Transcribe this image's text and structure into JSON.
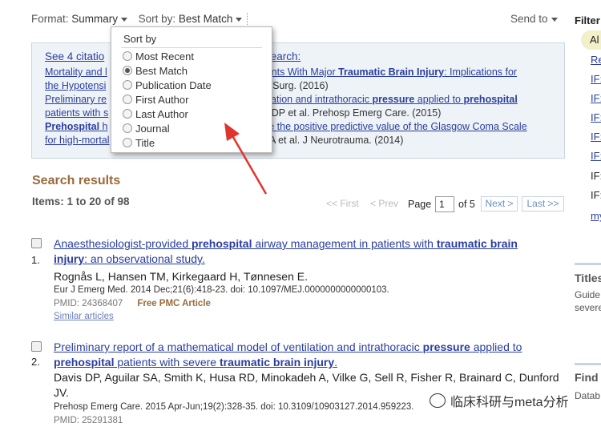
{
  "toolbar": {
    "format_label": "Format:",
    "format_value": "Summary",
    "sort_label": "Sort by:",
    "sort_value": "Best Match",
    "send_to": "Send to"
  },
  "citations": {
    "see_prefix": "See 4 citatio",
    "see_suffix": "search:",
    "lines": [
      {
        "a": "Mortality and l",
        "b": "ients With Major ",
        "b_bold": "Traumatic Brain Injury",
        "b_end": ": Implications for"
      },
      {
        "a": "the Hypotensi",
        "b_plain": "A Surg. (2016)"
      },
      {
        "a": "Preliminary re",
        "b": "tilation and intrathoracic ",
        "b_bold": "pressure",
        "b_mid": " applied to ",
        "b_bold2": "prehospital"
      },
      {
        "a": "patients with s",
        "b_plain": "s DP et al. Prehosp Emerg Care. (2015)"
      },
      {
        "a_bold": "Prehospital",
        "a": " h",
        "b": "se the positive predictive value of the Glasgow Coma Scale"
      },
      {
        "a": "for high-mortal",
        "b_plain": "r A et al. J Neurotrauma. (2014)"
      }
    ]
  },
  "sort_menu": {
    "title": "Sort by",
    "options": [
      "Most Recent",
      "Best Match",
      "Publication Date",
      "First Author",
      "Last Author",
      "Journal",
      "Title"
    ],
    "selected": "Best Match"
  },
  "results_header": {
    "title": "Search results",
    "items": "Items: 1 to 20 of 98"
  },
  "pagination": {
    "first": "<< First",
    "prev": "< Prev",
    "page_label": "Page",
    "page_value": "1",
    "of": "of 5",
    "next": "Next >",
    "last": "Last >>"
  },
  "results": [
    {
      "num": "1.",
      "title_l1": "Anaesthesiologist-provided ",
      "title_l1_b": "prehospital",
      "title_l1_c": " airway management in patients with ",
      "title_l1_d": "traumatic brain",
      "title_l2_b": "injury",
      "title_l2_c": ": an observational study.",
      "authors": "Rognås L, Hansen TM, Kirkegaard H, Tønnesen E.",
      "source": "Eur J Emerg Med. 2014 Dec;21(6):418-23. doi: 10.1097/MEJ.0000000000000103.",
      "pmid": "PMID: 24368407",
      "free": "Free PMC Article",
      "similar": "Similar articles"
    },
    {
      "num": "2.",
      "title_l1": "Preliminary report of a mathematical model of ventilation and intrathoracic ",
      "title_l1_b": "pressure",
      "title_l1_c": " applied to",
      "title_l2_b": "prehospital",
      "title_l2_c": " patients with severe ",
      "title_l2_d": "traumatic brain injury",
      "title_l2_e": ".",
      "authors_l1": "Davis DP, Aguilar SA, Smith K, Husa RD, Minokadeh A, Vilke G, Sell R, Fisher R, Brainard C, Dunford",
      "authors_l2": "JV.",
      "source": "Prehosp Emerg Care. 2015 Apr-Jun;19(2):328-35. doi: 10.3109/10903127.2014.959223.",
      "pmid": "PMID: 25291381"
    }
  ],
  "sidebar": {
    "filter_title": "Filter",
    "items": [
      "Al",
      "Re",
      "IF:",
      "IF:",
      "IF:",
      "IF:",
      "IF:",
      "IF:",
      "IF:",
      "my"
    ],
    "titles_heading": "Titles",
    "titles_l1": "Guide",
    "titles_l2": "severe",
    "find_heading": "Find",
    "find_l1": "Datab"
  },
  "watermark": "临床科研与meta分析",
  "colors": {
    "link": "#2a3e9e",
    "heading_brown": "#9a6a3c",
    "arrow": "#e0342e"
  }
}
